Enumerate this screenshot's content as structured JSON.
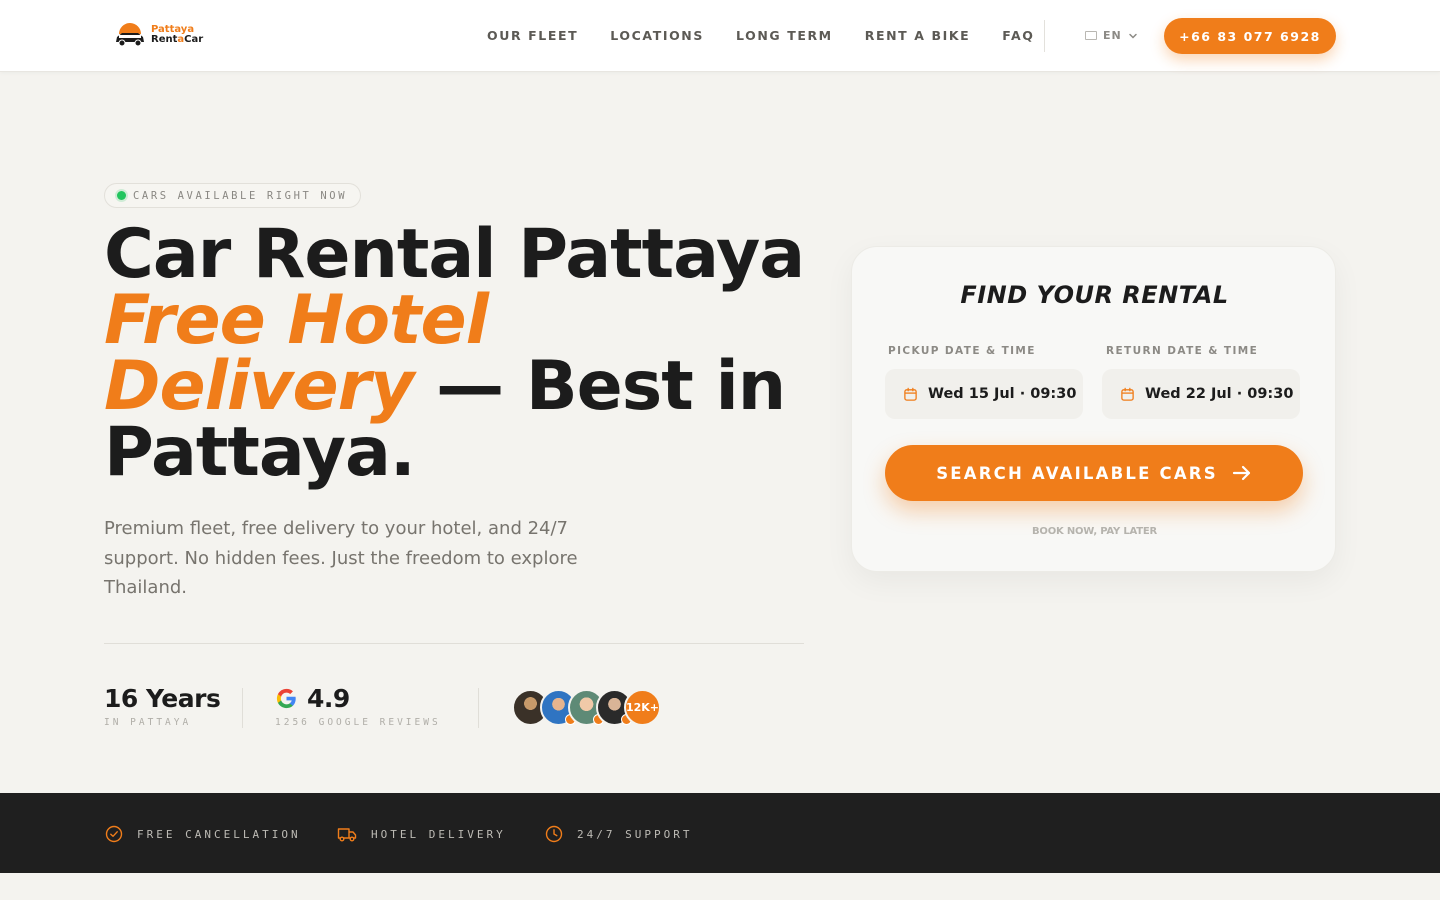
{
  "header": {
    "logo": {
      "line1": "Pattaya",
      "line2_a": "Rent",
      "line2_b": "a",
      "line2_c": "Car"
    },
    "nav": [
      "OUR FLEET",
      "LOCATIONS",
      "LONG TERM",
      "RENT A BIKE",
      "FAQ"
    ],
    "language": "EN",
    "phone": "+66 83 077 6928"
  },
  "hero": {
    "availability_pill": "CARS AVAILABLE RIGHT NOW",
    "headline_part1": "Car Rental Pattaya",
    "headline_accent1": "Free Hotel",
    "headline_accent2": "Delivery",
    "headline_part2": " — Best in Pattaya.",
    "subtext": "Premium fleet, free delivery to your hotel, and 24/7 support. No hidden fees. Just the freedom to explore Thailand.",
    "stats": {
      "years_value": "16 Years",
      "years_label": "IN PATTAYA",
      "rating_value": "4.9",
      "rating_label": "1256 GOOGLE REVIEWS",
      "customers_badge": "12K+"
    }
  },
  "search_card": {
    "title": "FIND YOUR RENTAL",
    "pickup_label": "PICKUP DATE & TIME",
    "pickup_value": "Wed 15 Jul · 09:30",
    "return_label": "RETURN DATE & TIME",
    "return_value": "Wed 22 Jul · 09:30",
    "search_button": "SEARCH AVAILABLE CARS",
    "note": "BOOK NOW, PAY LATER"
  },
  "features": [
    "FREE CANCELLATION",
    "HOTEL DELIVERY",
    "24/7 SUPPORT"
  ],
  "colors": {
    "accent": "#f07d1a",
    "dark_band": "#1f1f1f",
    "background": "#f4f3ef",
    "live_dot": "#22c55e"
  }
}
